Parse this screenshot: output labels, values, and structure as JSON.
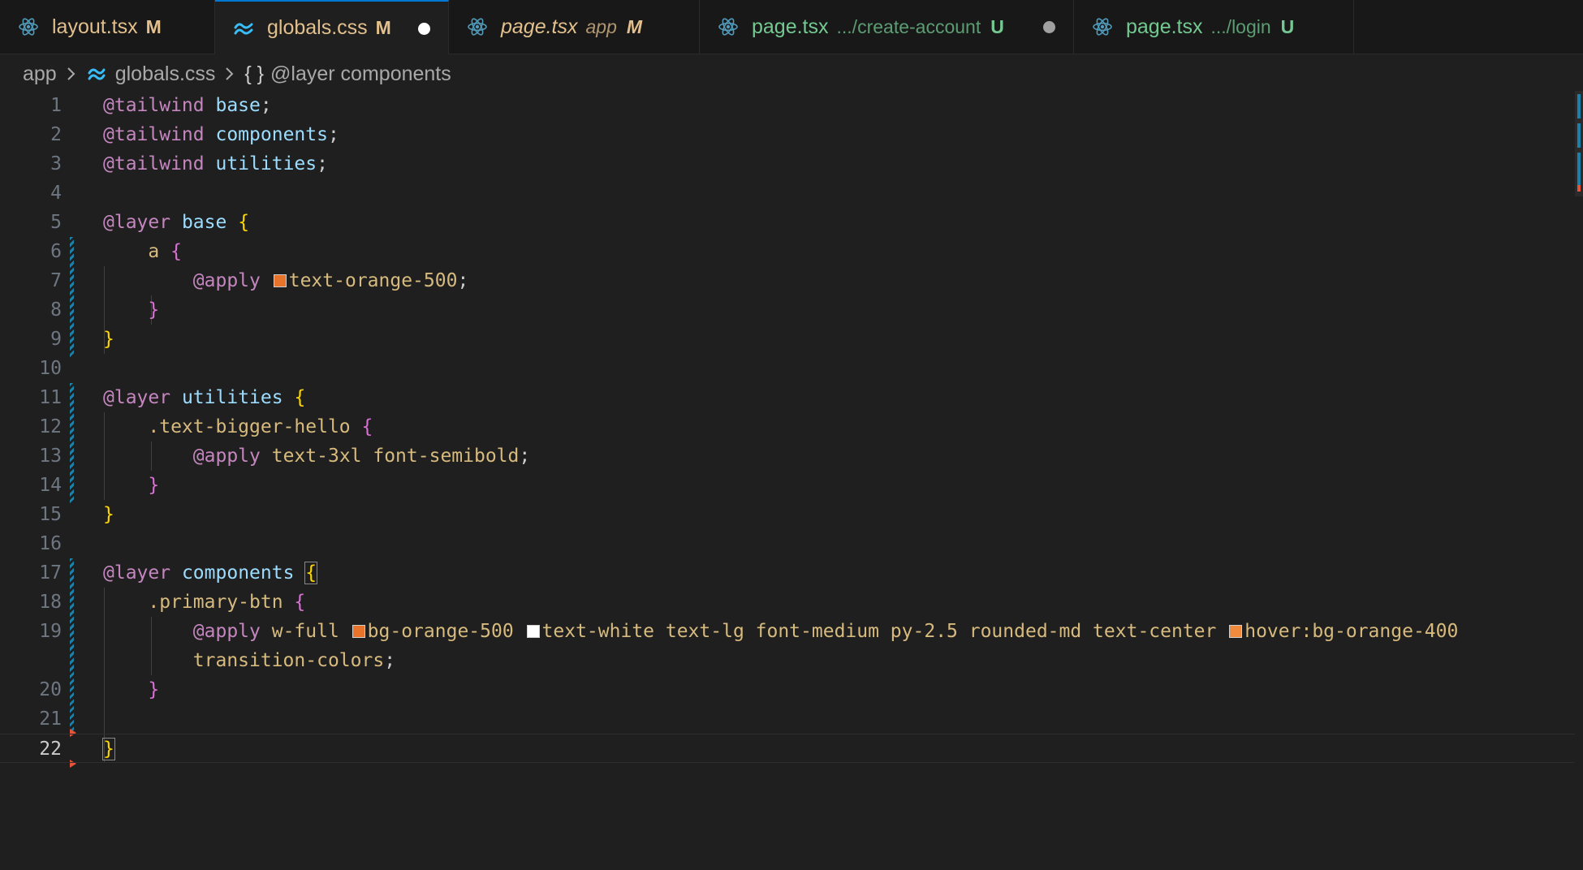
{
  "tabs": [
    {
      "name": "layout.tsx",
      "desc": "",
      "status": "M",
      "icon": "react-icon",
      "name_color": "#e2c08d",
      "status_color": "#e2c08d",
      "italic": false,
      "active": false,
      "dirty": false,
      "width": 265
    },
    {
      "name": "globals.css",
      "desc": "",
      "status": "M",
      "icon": "tailwind-icon",
      "name_color": "#e2c08d",
      "status_color": "#e2c08d",
      "italic": false,
      "active": true,
      "dirty": true,
      "dirty_color": "#ffffff",
      "width": 288
    },
    {
      "name": "page.tsx",
      "desc": "app",
      "status": "M",
      "icon": "react-icon",
      "name_color": "#e2c08d",
      "status_color": "#e2c08d",
      "italic": true,
      "active": false,
      "dirty": false,
      "width": 309
    },
    {
      "name": "page.tsx",
      "desc": ".../create-account",
      "status": "U",
      "icon": "react-icon",
      "name_color": "#73c991",
      "status_color": "#73c991",
      "italic": false,
      "active": false,
      "dirty": true,
      "dirty_color": "#a0a0a0",
      "width": 461
    },
    {
      "name": "page.tsx",
      "desc": ".../login",
      "status": "U",
      "icon": "react-icon",
      "name_color": "#73c991",
      "status_color": "#73c991",
      "italic": false,
      "active": false,
      "dirty": false,
      "width": 345
    }
  ],
  "breadcrumb": {
    "folder": "app",
    "file": "globals.css",
    "symbol_icon": "{ }",
    "symbol": "@layer components"
  },
  "editor": {
    "current_line": 22,
    "lines": [
      {
        "n": "1",
        "tokens": [
          [
            "@tailwind",
            "at"
          ],
          [
            " ",
            "punct"
          ],
          [
            "base",
            "id"
          ],
          [
            ";",
            "punct"
          ]
        ]
      },
      {
        "n": "2",
        "tokens": [
          [
            "@tailwind",
            "at"
          ],
          [
            " ",
            "punct"
          ],
          [
            "components",
            "id"
          ],
          [
            ";",
            "punct"
          ]
        ]
      },
      {
        "n": "3",
        "tokens": [
          [
            "@tailwind",
            "at"
          ],
          [
            " ",
            "punct"
          ],
          [
            "utilities",
            "id"
          ],
          [
            ";",
            "punct"
          ]
        ]
      },
      {
        "n": "4",
        "tokens": []
      },
      {
        "n": "5",
        "tokens": [
          [
            "@layer",
            "at"
          ],
          [
            " ",
            "punct"
          ],
          [
            "base",
            "id"
          ],
          [
            " ",
            "punct"
          ],
          [
            "{",
            "brace-y"
          ]
        ]
      },
      {
        "n": "6",
        "tokens": [
          [
            "    ",
            "punct"
          ],
          [
            "a",
            "sel"
          ],
          [
            " ",
            "punct"
          ],
          [
            "{",
            "brace-p"
          ]
        ]
      },
      {
        "n": "7",
        "tokens": [
          [
            "        ",
            "punct"
          ],
          [
            "@apply",
            "at"
          ],
          [
            " ",
            "punct"
          ],
          [
            "#e8742c",
            "swatch"
          ],
          [
            "text-orange-500",
            "sel"
          ],
          [
            ";",
            "punct"
          ]
        ]
      },
      {
        "n": "8",
        "tokens": [
          [
            "    ",
            "punct"
          ],
          [
            "}",
            "brace-p"
          ]
        ]
      },
      {
        "n": "9",
        "tokens": [
          [
            "}",
            "brace-y"
          ]
        ]
      },
      {
        "n": "10",
        "tokens": []
      },
      {
        "n": "11",
        "tokens": [
          [
            "@layer",
            "at"
          ],
          [
            " ",
            "punct"
          ],
          [
            "utilities",
            "id"
          ],
          [
            " ",
            "punct"
          ],
          [
            "{",
            "brace-y"
          ]
        ]
      },
      {
        "n": "12",
        "tokens": [
          [
            "    ",
            "punct"
          ],
          [
            ".text-bigger-hello",
            "sel"
          ],
          [
            " ",
            "punct"
          ],
          [
            "{",
            "brace-p"
          ]
        ]
      },
      {
        "n": "13",
        "tokens": [
          [
            "        ",
            "punct"
          ],
          [
            "@apply",
            "at"
          ],
          [
            " ",
            "punct"
          ],
          [
            "text-3xl font-semibold",
            "sel"
          ],
          [
            ";",
            "punct"
          ]
        ]
      },
      {
        "n": "14",
        "tokens": [
          [
            "    ",
            "punct"
          ],
          [
            "}",
            "brace-p"
          ]
        ]
      },
      {
        "n": "15",
        "tokens": [
          [
            "}",
            "brace-y"
          ]
        ]
      },
      {
        "n": "16",
        "tokens": []
      },
      {
        "n": "17",
        "tokens": [
          [
            "@layer",
            "at"
          ],
          [
            " ",
            "punct"
          ],
          [
            "components",
            "id"
          ],
          [
            " ",
            "punct"
          ],
          [
            "{",
            "brace-y-box"
          ]
        ]
      },
      {
        "n": "18",
        "tokens": [
          [
            "    ",
            "punct"
          ],
          [
            ".primary-btn",
            "sel"
          ],
          [
            " ",
            "punct"
          ],
          [
            "{",
            "brace-p"
          ]
        ]
      },
      {
        "n": "19",
        "tokens": [
          [
            "        ",
            "punct"
          ],
          [
            "@apply",
            "at"
          ],
          [
            " ",
            "punct"
          ],
          [
            "w-full ",
            "sel"
          ],
          [
            "#e8742c",
            "swatch"
          ],
          [
            "bg-orange-500 ",
            "sel"
          ],
          [
            "#ffffff",
            "swatch"
          ],
          [
            "text-white text-lg font-medium py-2.5 rounded-md text-center ",
            "sel"
          ],
          [
            "#f08a3c",
            "swatch"
          ],
          [
            "hover:bg-orange-400",
            "sel"
          ]
        ]
      },
      {
        "n": "",
        "tokens": [
          [
            "        ",
            "punct"
          ],
          [
            "transition-colors",
            "sel"
          ],
          [
            ";",
            "punct"
          ]
        ]
      },
      {
        "n": "20",
        "tokens": [
          [
            "    ",
            "punct"
          ],
          [
            "}",
            "brace-p"
          ]
        ]
      },
      {
        "n": "21",
        "tokens": []
      },
      {
        "n": "22",
        "tokens": [
          [
            "}",
            "brace-y-box"
          ]
        ]
      }
    ]
  },
  "colors": {
    "editor_bg": "#1f1f1f",
    "tabbar_bg": "#181818",
    "active_tab_border": "#0078d4",
    "modified": "#e2c08d",
    "untracked": "#73c991"
  }
}
